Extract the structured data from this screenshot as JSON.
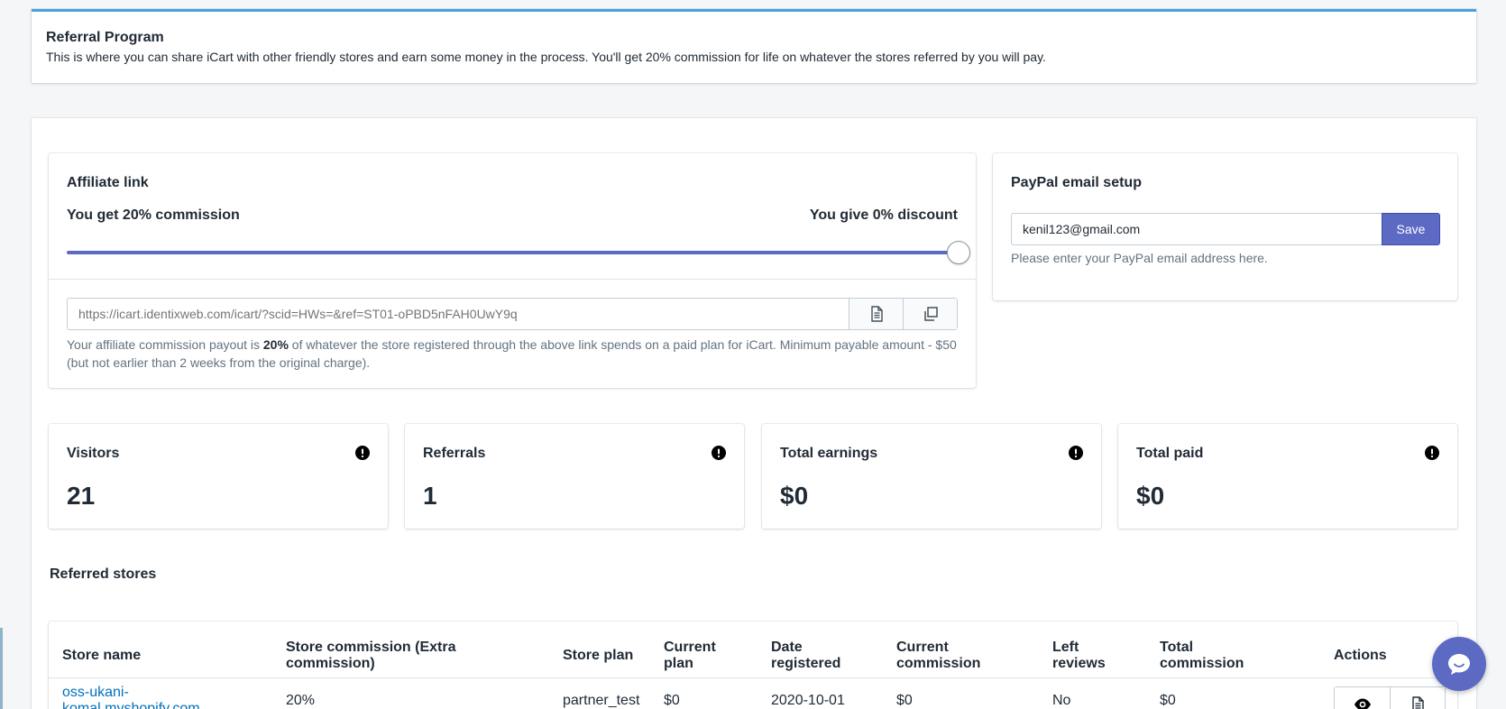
{
  "banner": {
    "title": "Referral Program",
    "description": "This is where you can share iCart with other friendly stores and earn some money in the process. You'll get 20% commission for life on whatever the stores referred by you will pay."
  },
  "affiliate": {
    "title": "Affiliate link",
    "commission_label": "You get 20% commission",
    "discount_label": "You give 0% discount",
    "slider_commission_fraction": 1.0,
    "link_placeholder": "https://icart.identixweb.com/icart/?scid=HWs=&ref=ST01-oPBD5nFAH0UwY9q",
    "help_prefix": "Your affiliate commission payout is ",
    "help_bold": "20%",
    "help_suffix": " of whatever the store registered through the above link spends on a paid plan for iCart. Minimum payable amount - $50 (but not earlier than 2 weeks from the original charge).",
    "icons": {
      "document": "document-icon",
      "copy": "copy-icon"
    }
  },
  "paypal": {
    "title": "PayPal email setup",
    "email_value": "kenil123@gmail.com",
    "save_label": "Save",
    "help": "Please enter your PayPal email address here."
  },
  "stats": [
    {
      "label": "Visitors",
      "value": "21"
    },
    {
      "label": "Referrals",
      "value": "1"
    },
    {
      "label": "Total earnings",
      "value": "$0"
    },
    {
      "label": "Total paid",
      "value": "$0"
    }
  ],
  "referred": {
    "title": "Referred stores",
    "columns": {
      "store_name": "Store name",
      "store_commission_1": "Store commission (Extra",
      "store_commission_2": "commission)",
      "store_plan": "Store plan",
      "current_plan_1": "Current",
      "current_plan_2": "plan",
      "date_registered_1": "Date",
      "date_registered_2": "registered",
      "current_commission_1": "Current",
      "current_commission_2": "commission",
      "left_reviews_1": "Left",
      "left_reviews_2": "reviews",
      "total_commission_1": "Total",
      "total_commission_2": "commission",
      "actions": "Actions"
    },
    "rows": [
      {
        "store_name_1": "oss-ukani-",
        "store_name_2": "komal.myshopify.com",
        "store_commission": "20%",
        "store_plan": "partner_test",
        "current_plan": "$0",
        "date_registered": "2020-10-01",
        "current_commission": "$0",
        "left_reviews": "No",
        "total_commission": "$0"
      }
    ]
  },
  "colors": {
    "accent": "#5c6ac4",
    "banner_border": "#47a3dc",
    "link": "#006fbb",
    "background": "#f4f6f8"
  }
}
